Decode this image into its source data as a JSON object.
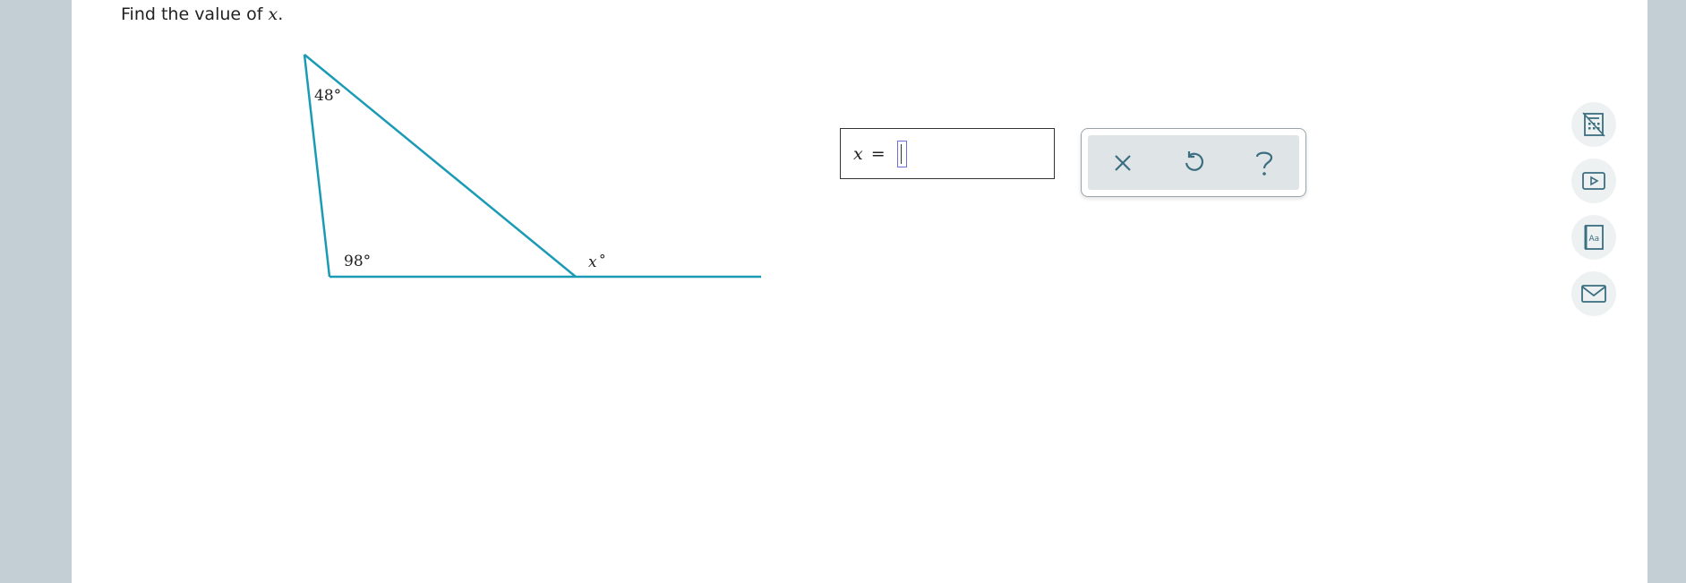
{
  "question": {
    "prompt_prefix": "Find the value of ",
    "prompt_variable": "x",
    "prompt_suffix": "."
  },
  "figure": {
    "angle_top": "48°",
    "angle_bottom_left": "98°",
    "angle_exterior_var": "x",
    "angle_exterior_degree": "°",
    "line_color": "#1a9bb5"
  },
  "answer": {
    "variable": "x",
    "equals": "=",
    "value": ""
  },
  "tools": {
    "clear": "clear-icon",
    "undo": "undo-icon",
    "help": "help-icon"
  },
  "side_toolbar": [
    "calculator-icon",
    "video-icon",
    "glossary-icon",
    "message-icon"
  ],
  "colors": {
    "accent": "#1a9bb5",
    "icon": "#3b6e80",
    "margin_bg": "#c3cfd5"
  }
}
